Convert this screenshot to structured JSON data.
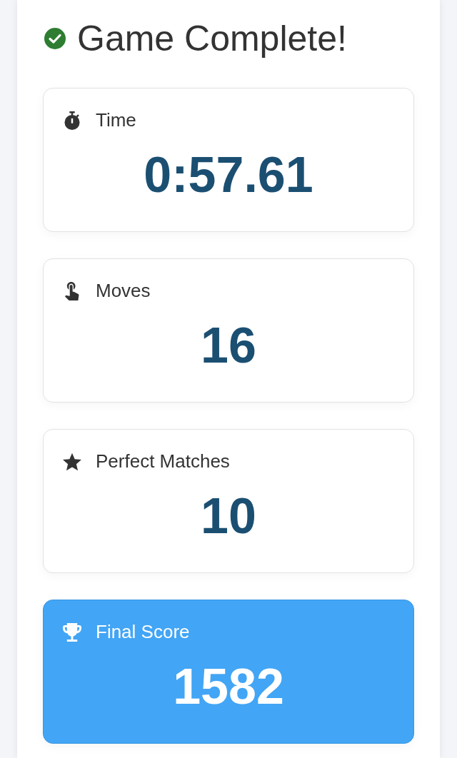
{
  "heading": {
    "text": "Game Complete!"
  },
  "stats": [
    {
      "kind": "time",
      "label": "Time",
      "value": "0:57.61",
      "highlighted": false
    },
    {
      "kind": "moves",
      "label": "Moves",
      "value": "16",
      "highlighted": false
    },
    {
      "kind": "matches",
      "label": "Perfect Matches",
      "value": "10",
      "highlighted": false
    },
    {
      "kind": "score",
      "label": "Final Score",
      "value": "1582",
      "highlighted": true
    }
  ]
}
